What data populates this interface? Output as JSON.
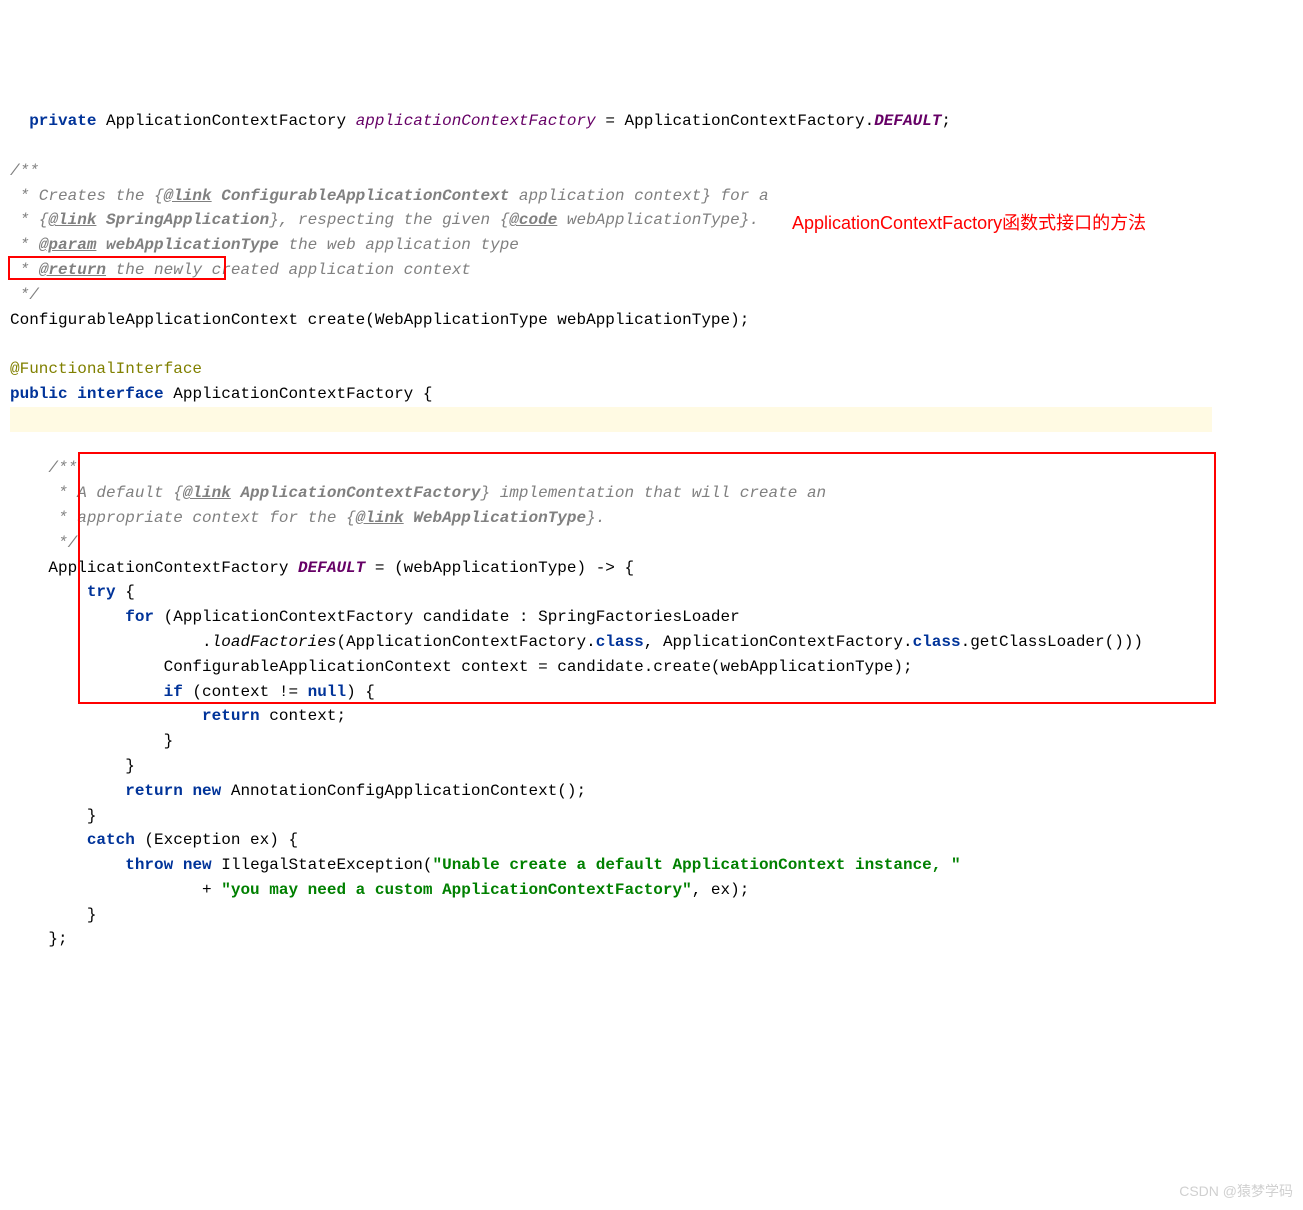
{
  "line1": {
    "private": "private",
    "type1": "ApplicationContextFactory",
    "field": "applicationContextFactory",
    "eq": " = ",
    "type2": "ApplicationContextFactory",
    "dot": ".",
    "default": "DEFAULT",
    "semi": ";"
  },
  "doc1": {
    "l1": "/**",
    "l2a": " * Creates the {",
    "l2tag": "@link",
    "l2b": " ConfigurableApplicationContext",
    "l2c": " application context} for a",
    "l3a": " * {",
    "l3tag": "@link",
    "l3b": " SpringApplication",
    "l3c": "}, respecting the given {",
    "l3tag2": "@code",
    "l3d": " webApplicationType}.",
    "l4a": " * ",
    "l4tag": "@param",
    "l4b": " webApplicationType",
    "l4c": " the web application type",
    "l5a": " * ",
    "l5tag": "@return",
    "l5b": " the newly created application context",
    "l6": " */"
  },
  "sig": {
    "type": "ConfigurableApplicationContext ",
    "method": "create",
    "params": "(WebApplicationType webApplicationType);"
  },
  "red_annotation": "ApplicationContextFactory函数式接口的方法",
  "iface": {
    "anno": "@FunctionalInterface",
    "public": "public",
    "interface": "interface",
    "name": " ApplicationContextFactory {"
  },
  "doc2": {
    "l1": "    /**",
    "l2a": "     * A default {",
    "l2tag": "@link",
    "l2b": " ApplicationContextFactory",
    "l2c": "} implementation that will create an",
    "l3a": "     * appropriate context for the {",
    "l3tag": "@link",
    "l3b": " WebApplicationType",
    "l3c": "}.",
    "l4": "     */"
  },
  "default_impl": {
    "l1a": "    ApplicationContextFactory ",
    "l1b": "DEFAULT",
    "l1c": " = (webApplicationType) -> {",
    "try": "try",
    "l2b": " {",
    "for": "for",
    "l3b": " (ApplicationContextFactory candidate : SpringFactoriesLoader",
    "l4a": "                    .",
    "l4m": "loadFactories",
    "l4b": "(ApplicationContextFactory.",
    "class": "class",
    "l4c": ", ApplicationContextFactory.",
    "l4d": ".getClassLoader()))",
    "l5": "                ConfigurableApplicationContext context = candidate.create(webApplicationType);",
    "if": "if",
    "l6b": " (context != ",
    "null": "null",
    "l6c": ") {",
    "return": "return",
    "l7b": " context;",
    "l8": "                }",
    "l9": "            }",
    "l10b": " ",
    "new": "new",
    "l10c": " AnnotationConfigApplicationContext();",
    "l11": "        }",
    "catch": "catch",
    "l12b": " (Exception ex) {",
    "throw": "throw",
    "l13c": " IllegalStateException(",
    "str1": "\"Unable create a default ApplicationContext instance, \"",
    "l14a": "                    + ",
    "str2": "\"you may need a custom ApplicationContextFactory\"",
    "l14b": ", ex);",
    "l15": "        }",
    "l16": "    };"
  },
  "watermark": "CSDN @猿梦学码"
}
